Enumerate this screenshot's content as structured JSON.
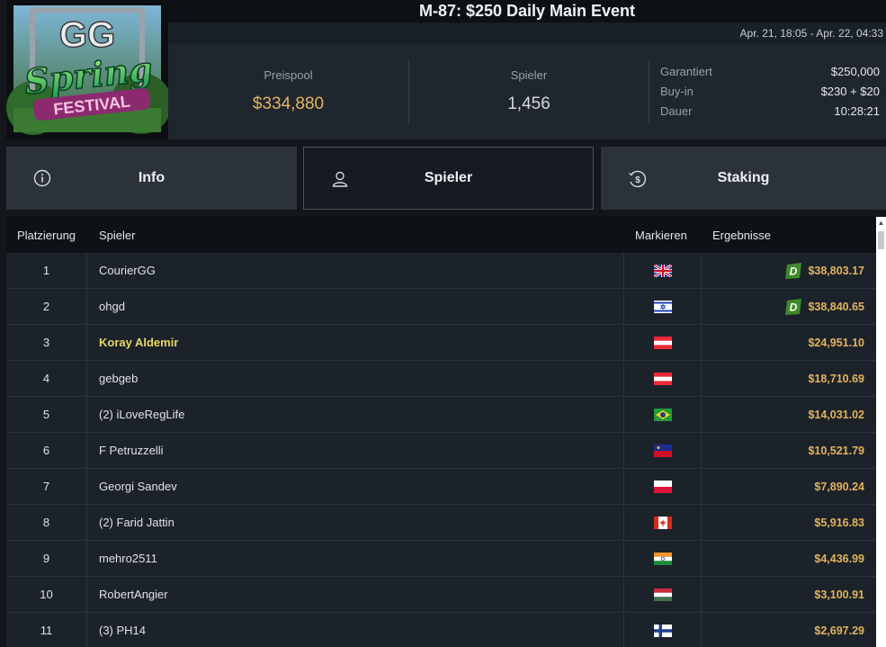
{
  "logo": {
    "top": "GG",
    "middle": "Spring",
    "bottom": "FESTIVAL"
  },
  "title": "M-87: $250 Daily Main Event",
  "dates": "Apr. 21, 18:05 - Apr. 22, 04:33",
  "stats": {
    "prizepool_label": "Preispool",
    "prizepool_value": "$334,880",
    "players_label": "Spieler",
    "players_value": "1,456"
  },
  "details": [
    {
      "label": "Garantiert",
      "value": "$250,000"
    },
    {
      "label": "Buy-in",
      "value": "$230 + $20"
    },
    {
      "label": "Dauer",
      "value": "10:28:21"
    }
  ],
  "tabs": [
    {
      "label": "Info",
      "icon": "info-icon"
    },
    {
      "label": "Spieler",
      "icon": "user-icon"
    },
    {
      "label": "Staking",
      "icon": "staking-icon"
    }
  ],
  "table": {
    "headers": {
      "rank": "Platzierung",
      "player": "Spieler",
      "flag": "Markieren",
      "result": "Ergebnisse"
    },
    "rows": [
      {
        "rank": "1",
        "player": "CourierGG",
        "flag": "gb",
        "result": "$38,803.17",
        "badge": "D"
      },
      {
        "rank": "2",
        "player": "ohgd",
        "flag": "il",
        "result": "$38,840.65",
        "badge": "D"
      },
      {
        "rank": "3",
        "player": "Koray Aldemir",
        "flag": "at",
        "result": "$24,951.10",
        "highlight": true
      },
      {
        "rank": "4",
        "player": "gebgeb",
        "flag": "at",
        "result": "$18,710.69"
      },
      {
        "rank": "5",
        "player": "(2) iLoveRegLife",
        "flag": "br",
        "result": "$14,031.02"
      },
      {
        "rank": "6",
        "player": "F Petruzzelli",
        "flag": "li",
        "result": "$10,521.79"
      },
      {
        "rank": "7",
        "player": "Georgi Sandev",
        "flag": "pl",
        "result": "$7,890.24"
      },
      {
        "rank": "8",
        "player": "(2) Farid Jattin",
        "flag": "ca",
        "result": "$5,916.83"
      },
      {
        "rank": "9",
        "player": "mehro2511",
        "flag": "in",
        "result": "$4,436.99"
      },
      {
        "rank": "10",
        "player": "RobertAngier",
        "flag": "hu",
        "result": "$3,100.91"
      },
      {
        "rank": "11",
        "player": "(3) PH14",
        "flag": "fi",
        "result": "$2,697.29"
      }
    ]
  },
  "colors": {
    "accent_gold": "#e3b45e",
    "highlight_name": "#e7d867",
    "badge_green": "#3f8a2c"
  }
}
